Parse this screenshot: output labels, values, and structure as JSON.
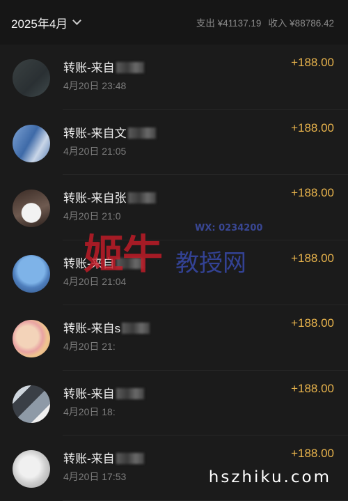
{
  "header": {
    "month": "2025年4月",
    "expense": "支出 ¥41137.19",
    "income": "收入 ¥88786.42"
  },
  "transactions": [
    {
      "title": "转账-来自",
      "time": "4月20日 23:48",
      "amount": "+188.00"
    },
    {
      "title": "转账-来自文",
      "time": "4月20日 21:05",
      "amount": "+188.00"
    },
    {
      "title": "转账-来自张",
      "time": "4月20日 21:0",
      "amount": "+188.00"
    },
    {
      "title": "转账-来自",
      "time": "4月20日 21:04",
      "amount": "+188.00"
    },
    {
      "title": "转账-来自s",
      "time": "4月20日 21:",
      "amount": "+188.00"
    },
    {
      "title": "转账-来自",
      "time": "4月20日 18:",
      "amount": "+188.00"
    },
    {
      "title": "转账-来自",
      "time": "4月20日 17:53",
      "amount": "+188.00"
    }
  ],
  "watermark": {
    "big": "姬牛",
    "small": "教授网",
    "id": "WX: 0234200"
  },
  "site_mark": "hszhiku.com",
  "colors": {
    "background": "#1b1b1b",
    "header_background": "#161616",
    "amount": "#e9b44c",
    "secondary_text": "#7d7d7d"
  }
}
